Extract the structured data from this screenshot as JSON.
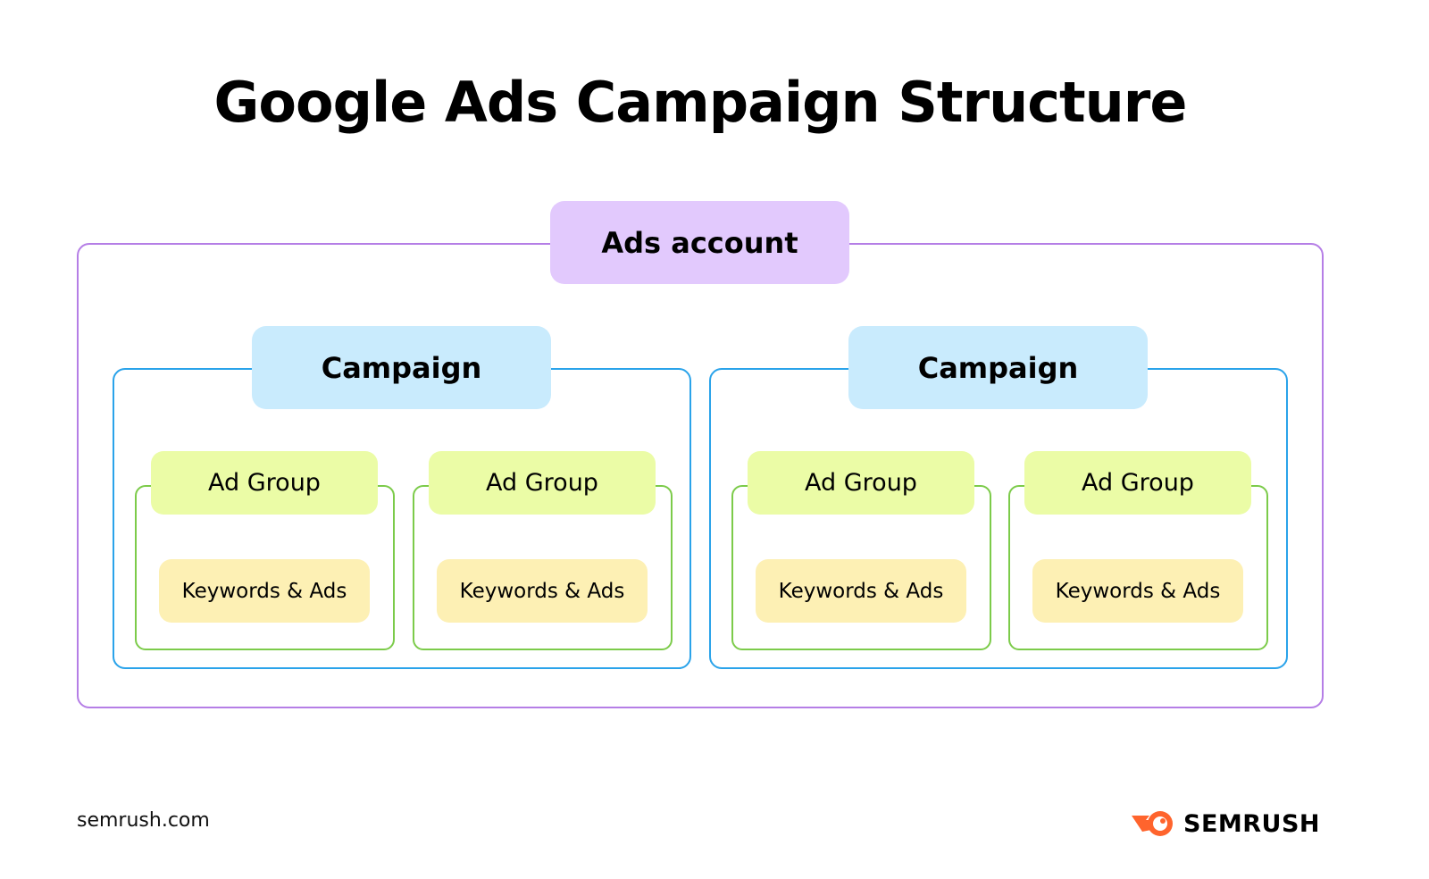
{
  "title": "Google Ads Campaign Structure",
  "account": {
    "label": "Ads account",
    "color": "#e2c9fd",
    "border": "#b57ee6"
  },
  "campaigns": [
    {
      "label": "Campaign",
      "ad_groups": [
        {
          "label": "Ad Group",
          "content": "Keywords & Ads"
        },
        {
          "label": "Ad Group",
          "content": "Keywords & Ads"
        }
      ]
    },
    {
      "label": "Campaign",
      "ad_groups": [
        {
          "label": "Ad Group",
          "content": "Keywords & Ads"
        },
        {
          "label": "Ad Group",
          "content": "Keywords & Ads"
        }
      ]
    }
  ],
  "colors": {
    "campaign_fill": "#c9ebfd",
    "campaign_border": "#2aa3ea",
    "ad_group_fill": "#ebfca6",
    "ad_group_border": "#7ccb4a",
    "keywords_fill": "#fdf0b4",
    "brand_orange": "#ff642d"
  },
  "footer": {
    "url": "semrush.com",
    "brand": "SEMRUSH",
    "logo_icon": "semrush-fireball-icon"
  }
}
